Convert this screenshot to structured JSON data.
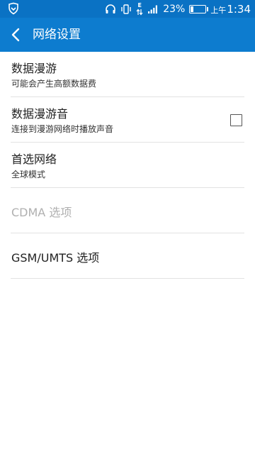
{
  "status_bar": {
    "battery_percent": "23%",
    "ampm": "上午",
    "time": "1:34",
    "network_type": "E",
    "icons": [
      "shield-icon",
      "headset-icon",
      "vibrate-icon",
      "data-arrows-icon",
      "signal-icon",
      "battery-icon"
    ]
  },
  "action_bar": {
    "title": "网络设置"
  },
  "settings": [
    {
      "title": "数据漫游",
      "summary": "可能会产生高额数据费"
    },
    {
      "title": "数据漫游音",
      "summary": "连接到漫游网络时播放声音",
      "checked": false
    },
    {
      "title": "首选网络",
      "summary": "全球模式"
    },
    {
      "title": "CDMA 选项",
      "enabled": false
    },
    {
      "title": "GSM/UMTS 选项"
    }
  ],
  "colors": {
    "status_bar": "#0a72c4",
    "action_bar": "#0d7ccf",
    "divider": "#e2e2e2",
    "disabled_text": "#b0b0b0"
  }
}
